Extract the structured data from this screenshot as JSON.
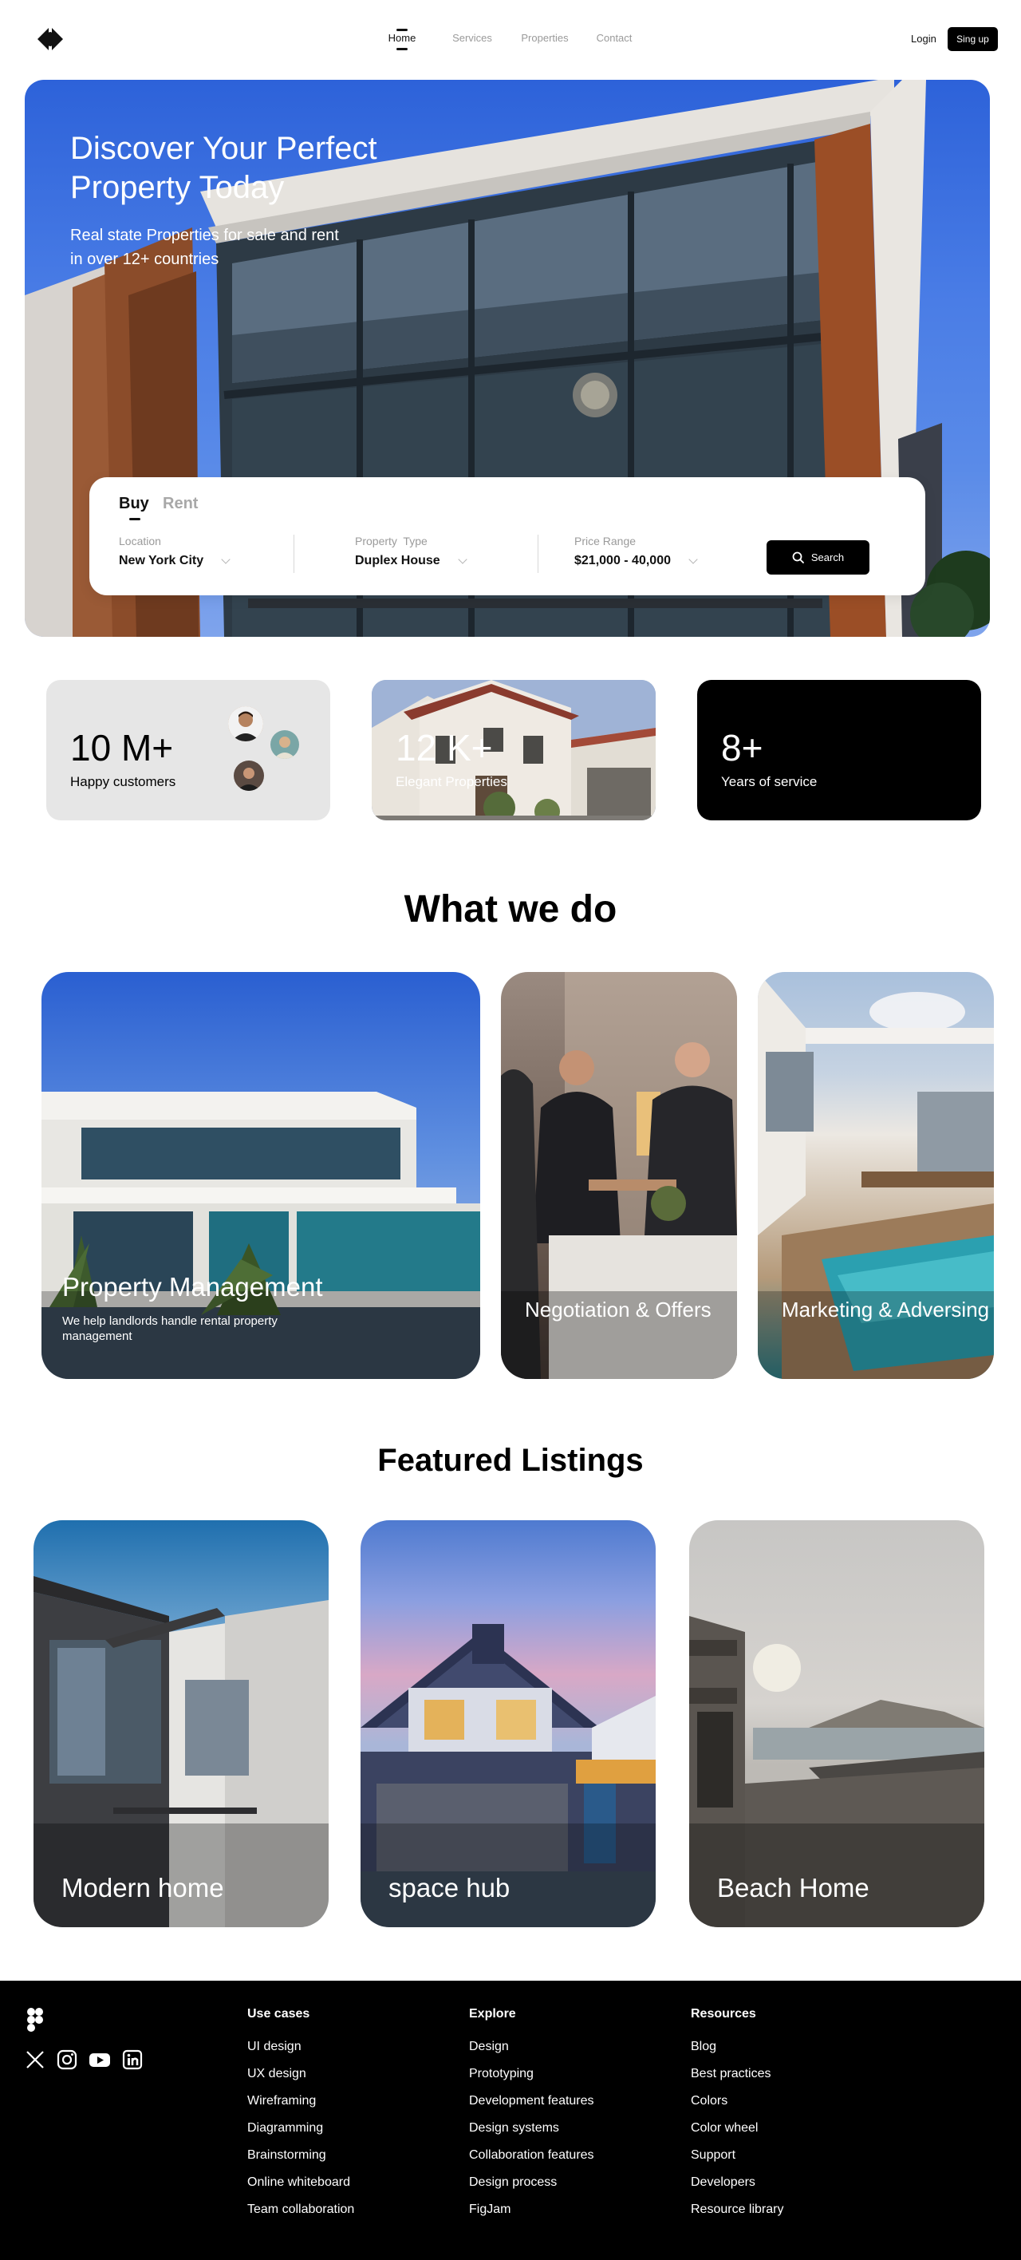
{
  "nav": {
    "links": [
      "Home",
      "Services",
      "Properties",
      "Contact"
    ],
    "login": "Login",
    "signup": "Sing up"
  },
  "hero": {
    "title": "Discover Your Perfect Property Today",
    "subtitle": "Real state Properties for sale and rent in over 12+ countries",
    "search": {
      "tabs": [
        "Buy",
        "Rent"
      ],
      "location_label": "Location",
      "location_value": "New York City",
      "type_label": "Property  Type",
      "type_value": "Duplex House",
      "price_label": "Price Range",
      "price_value": "$21,000 - 40,000",
      "button": "Search"
    }
  },
  "stats": [
    {
      "number": "10 M+",
      "label": "Happy customers"
    },
    {
      "number": "12 K+",
      "label": "Elegant Properties"
    },
    {
      "number": "8+",
      "label": "Years of service"
    }
  ],
  "services": {
    "title": "What we do",
    "cards": [
      {
        "title": "Property Management",
        "subtitle": "We help landlords handle rental property management"
      },
      {
        "title": "Negotiation & Offers"
      },
      {
        "title": "Marketing & Adversing"
      }
    ]
  },
  "featured": {
    "title": "Featured Listings",
    "listings": [
      "Modern home",
      "space hub",
      "Beach Home"
    ]
  },
  "footer": {
    "columns": [
      {
        "heading": "Use cases",
        "items": [
          "UI design",
          "UX design",
          "Wireframing",
          "Diagramming",
          "Brainstorming",
          "Online whiteboard",
          "Team collaboration"
        ]
      },
      {
        "heading": "Explore",
        "items": [
          "Design",
          "Prototyping",
          "Development features",
          "Design systems",
          "Collaboration features",
          "Design process",
          "FigJam"
        ]
      },
      {
        "heading": "Resources",
        "items": [
          "Blog",
          "Best practices",
          "Colors",
          "Color wheel",
          "Support",
          "Developers",
          "Resource library"
        ]
      }
    ],
    "social_icons": [
      "x-icon",
      "instagram-icon",
      "youtube-icon",
      "linkedin-icon"
    ]
  }
}
